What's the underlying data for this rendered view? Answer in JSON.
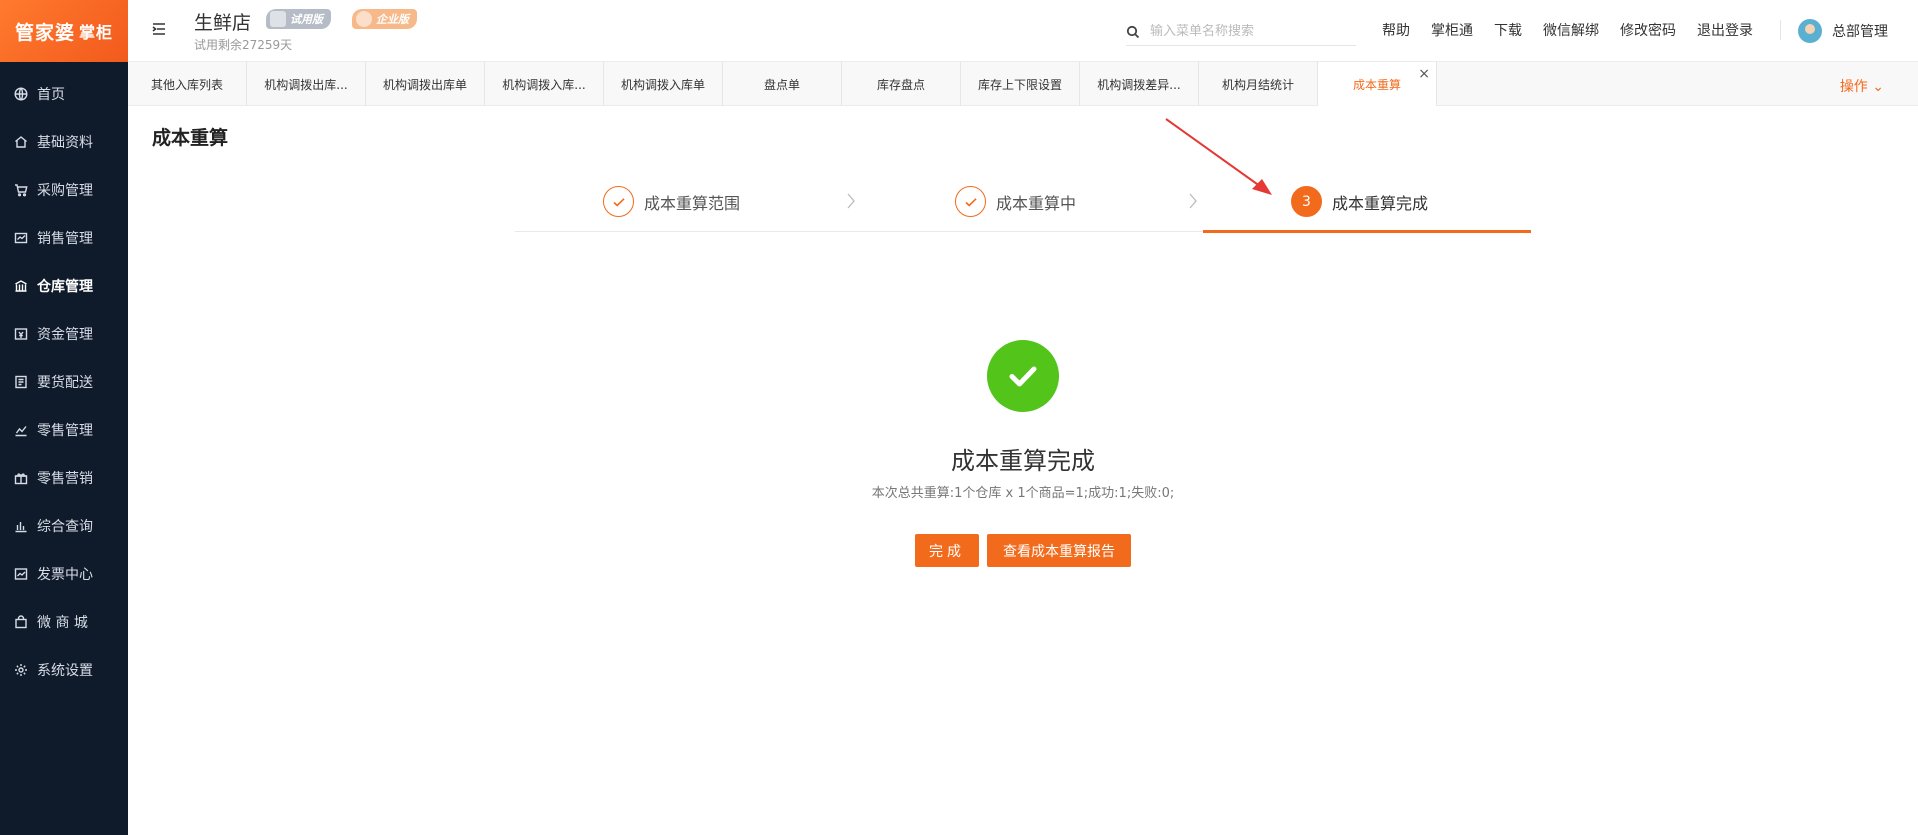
{
  "sidebar": {
    "logo": "管家婆",
    "logo_sub": "掌柜",
    "items": [
      {
        "label": "首页",
        "icon": "globe-icon"
      },
      {
        "label": "基础资料",
        "icon": "home-icon"
      },
      {
        "label": "采购管理",
        "icon": "cart-icon"
      },
      {
        "label": "销售管理",
        "icon": "sales-icon"
      },
      {
        "label": "仓库管理",
        "icon": "warehouse-icon"
      },
      {
        "label": "资金管理",
        "icon": "money-icon"
      },
      {
        "label": "要货配送",
        "icon": "delivery-icon"
      },
      {
        "label": "零售管理",
        "icon": "chart-icon"
      },
      {
        "label": "零售营销",
        "icon": "gift-icon"
      },
      {
        "label": "综合查询",
        "icon": "bar-chart-icon"
      },
      {
        "label": "发票中心",
        "icon": "invoice-icon"
      },
      {
        "label": "微 商 城",
        "icon": "shop-icon"
      },
      {
        "label": "系统设置",
        "icon": "gear-icon"
      }
    ]
  },
  "header": {
    "store_name": "生鲜店",
    "trial_info": "试用剩余27259天",
    "badge_trial": "试用版",
    "badge_enterprise": "企业版",
    "search_placeholder": "输入菜单名称搜索",
    "links": [
      "帮助",
      "掌柜通",
      "下载",
      "微信解绑",
      "修改密码",
      "退出登录"
    ],
    "user_name": "总部管理"
  },
  "tabs": [
    "其他入库列表",
    "机构调拨出库...",
    "机构调拨出库单",
    "机构调拨入库...",
    "机构调拨入库单",
    "盘点单",
    "库存盘点",
    "库存上下限设置",
    "机构调拨差异...",
    "机构月结统计",
    "成本重算"
  ],
  "tab_close": "×",
  "ops_label": "操作 ⌄",
  "page_title": "成本重算",
  "steps": [
    {
      "label": "成本重算范围",
      "status": "done"
    },
    {
      "label": "成本重算中",
      "status": "done"
    },
    {
      "label": "成本重算完成",
      "status": "current",
      "number": "3"
    }
  ],
  "result": {
    "title": "成本重算完成",
    "description": "本次总共重算:1个仓库 x 1个商品=1;成功:1;失败:0;",
    "done_button": "完成",
    "report_button": "查看成本重算报告"
  },
  "colors": {
    "accent": "#f26b1d",
    "sidebar_bg": "#0f1b2b",
    "success": "#52c41a",
    "annotation_arrow": "#e53935"
  }
}
